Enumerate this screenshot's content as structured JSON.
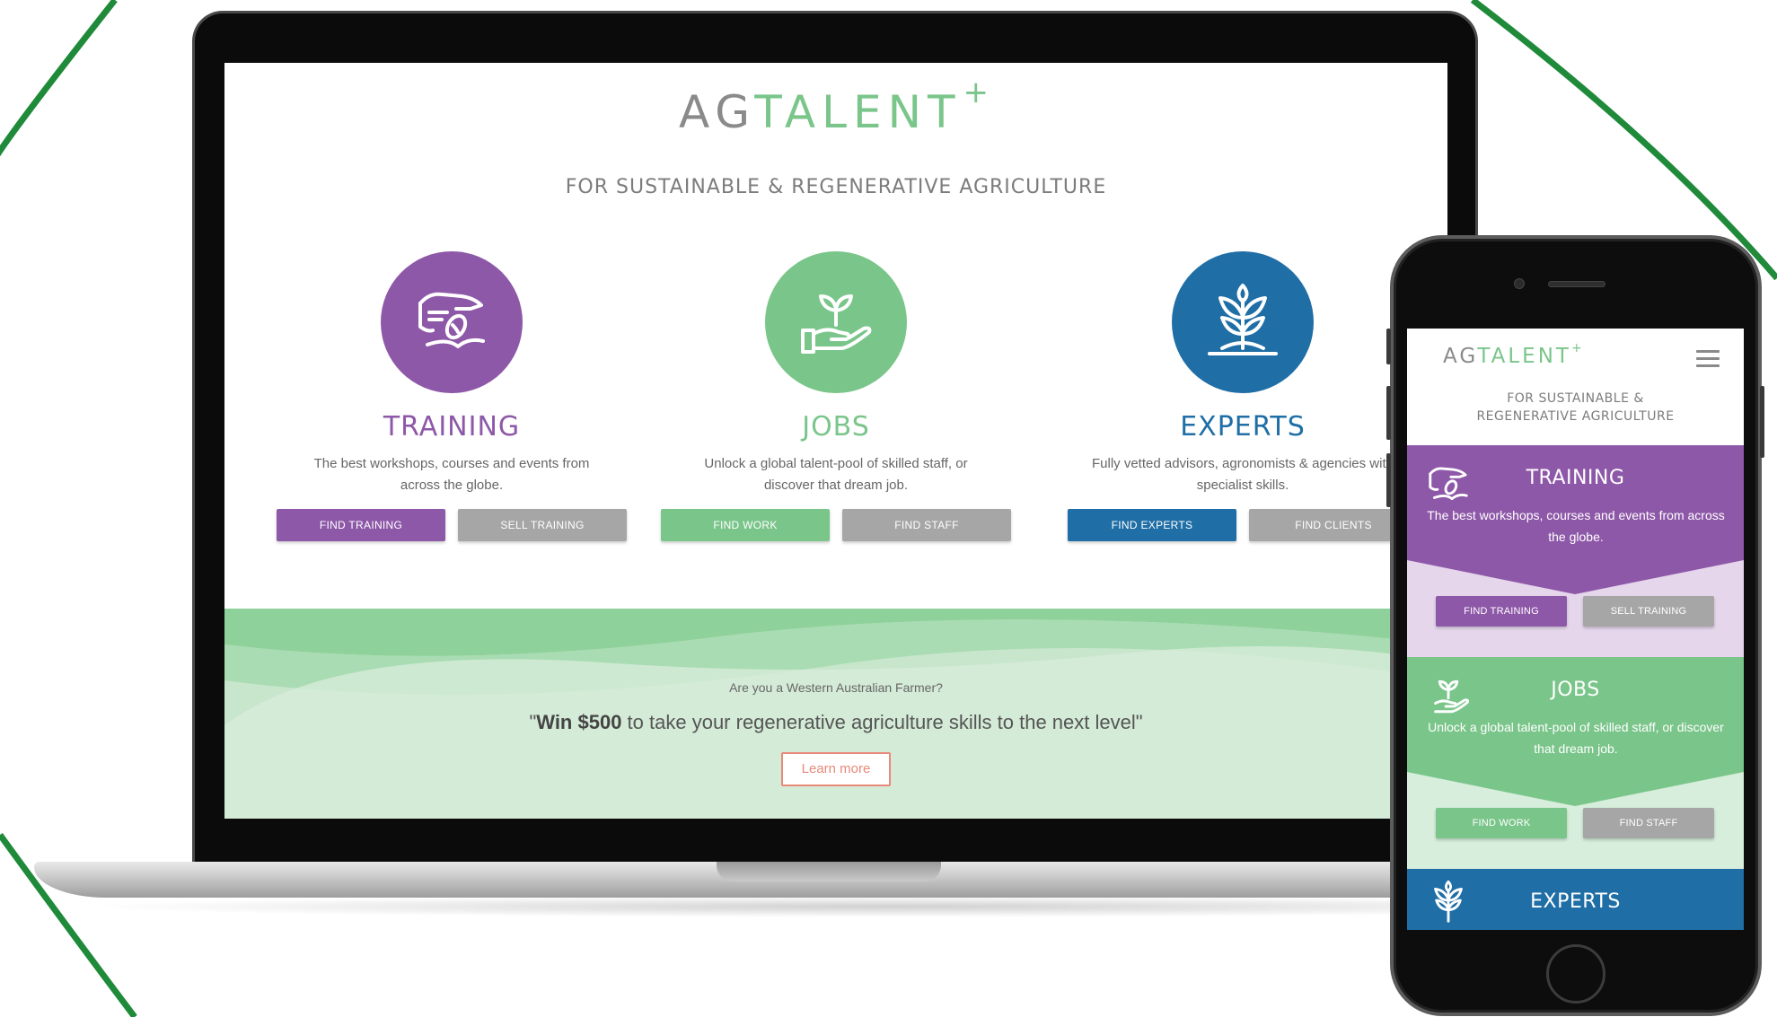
{
  "brand": {
    "logo_ag": "AG",
    "logo_talent": "TALENT",
    "logo_plus": "+",
    "tagline": "FOR SUSTAINABLE & REGENERATIVE AGRICULTURE",
    "tagline_mobile_line1": "FOR SUSTAINABLE &",
    "tagline_mobile_line2": "REGENERATIVE AGRICULTURE"
  },
  "colors": {
    "training": "#8e58a8",
    "jobs": "#7ac58a",
    "experts": "#1f6ea6",
    "grey_button": "#a6a6a6",
    "frame_arc": "#1f8a3a",
    "learn_more": "#e8897a"
  },
  "sections": [
    {
      "key": "training",
      "title": "TRAINING",
      "description": "The best workshops, courses and events from across the globe.",
      "icon": "hand-seed-icon",
      "primary_button": "FIND TRAINING",
      "secondary_button": "SELL TRAINING"
    },
    {
      "key": "jobs",
      "title": "JOBS",
      "description": "Unlock a global talent-pool of skilled staff, or discover that dream job.",
      "icon": "hand-sprout-icon",
      "primary_button": "FIND WORK",
      "secondary_button": "FIND STAFF"
    },
    {
      "key": "experts",
      "title": "EXPERTS",
      "description": "Fully vetted advisors, agronomists & agencies with specialist skills.",
      "icon": "plant-icon",
      "primary_button": "FIND EXPERTS",
      "secondary_button": "FIND CLIENTS"
    }
  ],
  "promo": {
    "question": "Are you a Western Australian Farmer?",
    "quote_open": "\"",
    "quote_bold": "Win $500",
    "quote_rest": " to take your regenerative agriculture skills to the next level\"",
    "cta": "Learn more"
  }
}
